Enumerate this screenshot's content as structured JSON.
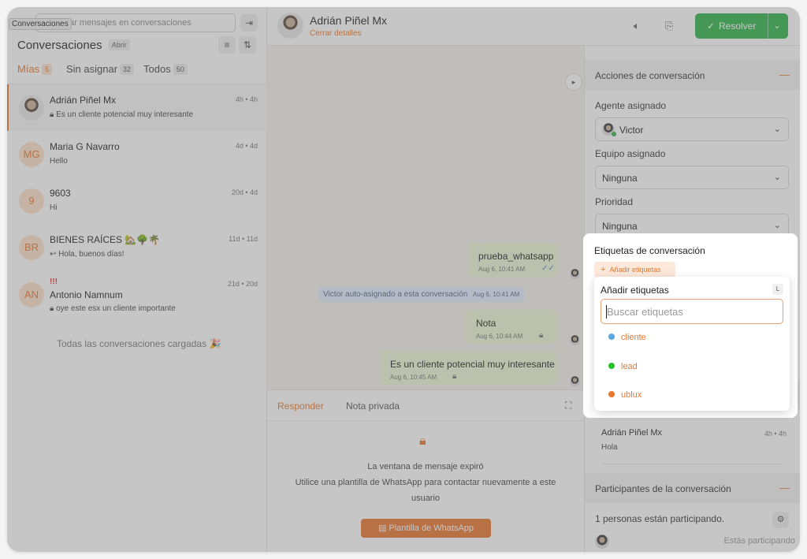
{
  "sidebar": {
    "tooltip": "Conversaciones",
    "search_placeholder": "ar mensajes en conversaciones",
    "title": "Conversaciones",
    "status_filter": "Abrir",
    "tabs": [
      {
        "label": "Mías",
        "count": "5"
      },
      {
        "label": "Sin asignar",
        "count": "32"
      },
      {
        "label": "Todos",
        "count": "50"
      }
    ],
    "conversations": [
      {
        "name": "Adrián Piñel Mx",
        "time": "4h • 4h",
        "subtitle": "Es un cliente potencial muy interesante",
        "initials": "",
        "flag": ""
      },
      {
        "name": "Maria G Navarro",
        "time": "4d • 4d",
        "subtitle": "Hello",
        "initials": "MG",
        "flag": ""
      },
      {
        "name": "9603",
        "time": "20d • 4d",
        "subtitle": "Hi",
        "initials": "9",
        "flag": ""
      },
      {
        "name": "BIENES RAÍCES 🏡🌳🌴",
        "time": "11d • 11d",
        "subtitle": "Hola, buenos días!",
        "initials": "BR",
        "flag": ""
      },
      {
        "name": "Antonio Namnum",
        "time": "21d • 20d",
        "subtitle": "oye este esx un cliente importante",
        "initials": "AN",
        "flag": "!!!"
      }
    ],
    "loaded_text": "Todas las conversaciones cargadas 🎉"
  },
  "header": {
    "contact_name": "Adrián Piñel Mx",
    "details_link": "Cerrar detalles",
    "resolve_label": "Resolver"
  },
  "chat": {
    "messages": [
      {
        "text": "prueba_whatsapp",
        "meta": "Aug 6, 10:41 AM"
      },
      {
        "text": "Nota",
        "meta": "Aug 6, 10:44 AM"
      },
      {
        "text": "Es un cliente potencial muy interesante",
        "meta": "Aug 6, 10:45 AM"
      }
    ],
    "system_message": "Victor auto-asignado a esta conversación",
    "system_meta": "Aug 6, 10:41 AM"
  },
  "reply": {
    "tab_reply": "Responder",
    "tab_private": "Nota privada",
    "expired_title": "La ventana de mensaje expiró",
    "expired_line1": "Utilice una plantilla de WhatsApp para contactar nuevamente a este",
    "expired_line2": "usuario",
    "template_button": "Plantilla de WhatsApp"
  },
  "details": {
    "actions_title": "Acciones de conversación",
    "agent_label": "Agente asignado",
    "agent_value": "Victor",
    "team_label": "Equipo asignado",
    "team_value": "Ninguna",
    "priority_label": "Prioridad",
    "priority_value": "Ninguna",
    "labels_title": "Etiquetas de conversación",
    "add_labels_button": "Añadir etiquetas",
    "dropdown": {
      "title": "Añadir etiquetas",
      "shortcut": "L",
      "search_placeholder": "Buscar etiquetas",
      "items": [
        {
          "label": "cliente",
          "color": "#5aa6e0"
        },
        {
          "label": "lead",
          "color": "#25c22a"
        },
        {
          "label": "ublux",
          "color": "#e8772e"
        }
      ]
    },
    "previous_name": "Adrián Piñel Mx",
    "previous_time": "4h • 4h",
    "previous_subtitle": "Hola",
    "participants_title": "Participantes de la conversación",
    "participants_text": "1 personas están participando.",
    "participating_status": "Estás participando"
  }
}
